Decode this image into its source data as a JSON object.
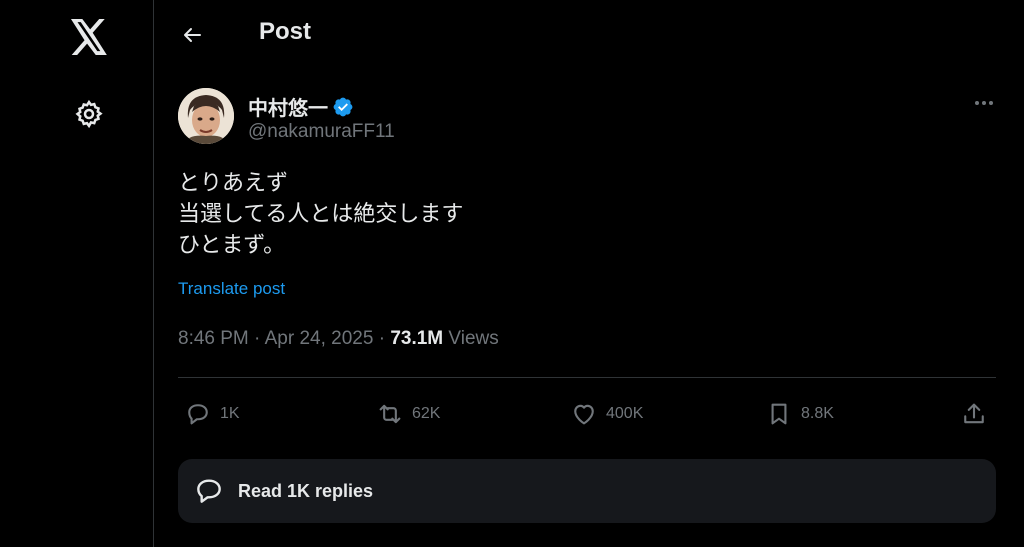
{
  "nav": {
    "logo_icon": "x-logo-icon",
    "settings_icon": "gear-icon"
  },
  "header": {
    "title": "Post",
    "back_icon": "arrow-left-icon"
  },
  "post": {
    "author": {
      "display_name": "中村悠一",
      "handle": "@nakamuraFF11",
      "verified": true
    },
    "text_lines": [
      "とりあえず",
      "当選してる人とは絶交します",
      "ひとまず。"
    ],
    "translate_label": "Translate post",
    "time": "8:46 PM",
    "date": "Apr 24, 2025",
    "separator": "·",
    "views_count": "73.1M",
    "views_label": "Views"
  },
  "actions": {
    "replies": "1K",
    "reposts": "62K",
    "likes": "400K",
    "bookmarks": "8.8K"
  },
  "read_replies": {
    "label": "Read 1K replies"
  },
  "colors": {
    "background": "#000000",
    "text": "#e7e9ea",
    "muted": "#71767b",
    "accent": "#1d9bf0",
    "border": "#2f3336"
  }
}
